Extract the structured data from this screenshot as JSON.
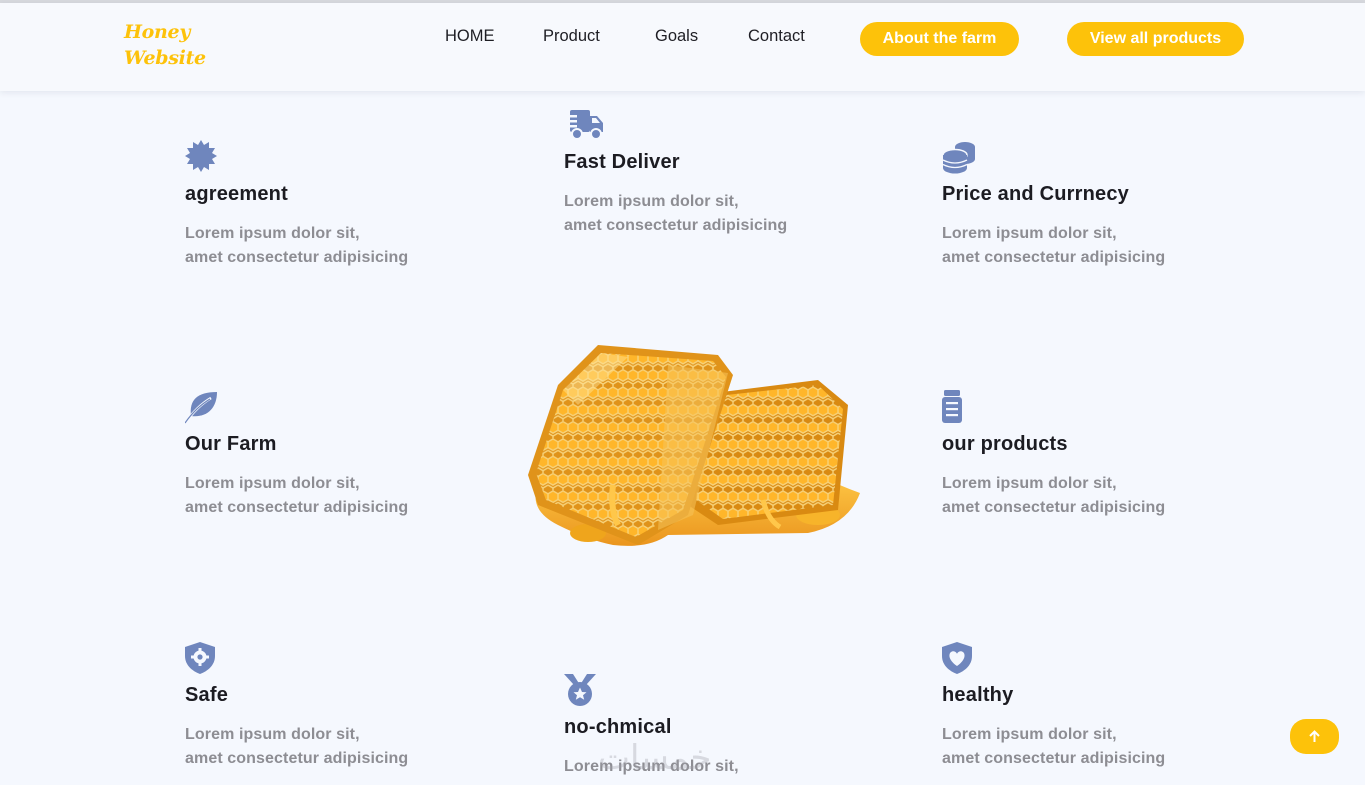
{
  "header": {
    "logo_line1": "Honey",
    "logo_line2": "Website",
    "nav": [
      "HOME",
      "Product",
      "Goals",
      "Contact"
    ],
    "btn_about": "About the farm",
    "btn_products": "View all products"
  },
  "features": [
    {
      "icon": "badge-icon",
      "title": "agreement",
      "line1": "Lorem ipsum dolor sit,",
      "line2": "amet consectetur adipisicing"
    },
    {
      "icon": "truck-fast-icon",
      "title": "Fast Deliver",
      "line1": "Lorem ipsum dolor sit,",
      "line2": "amet consectetur adipisicing"
    },
    {
      "icon": "coins-icon",
      "title": "Price and Currnecy",
      "line1": "Lorem ipsum dolor sit,",
      "line2": "amet consectetur adipisicing"
    },
    {
      "icon": "leaf-icon",
      "title": "Our Farm",
      "line1": "Lorem ipsum dolor sit,",
      "line2": "amet consectetur adipisicing"
    },
    {
      "icon": "jar-icon",
      "title": "our products",
      "line1": "Lorem ipsum dolor sit,",
      "line2": "amet consectetur adipisicing"
    },
    {
      "icon": "shield-gear-icon",
      "title": "Safe",
      "line1": "Lorem ipsum dolor sit,",
      "line2": "amet consectetur adipisicing"
    },
    {
      "icon": "medal-icon",
      "title": "no-chmical",
      "line1": "Lorem ipsum dolor sit,"
    },
    {
      "icon": "shield-heart-icon",
      "title": "healthy",
      "line1": "Lorem ipsum dolor sit,",
      "line2": "amet consectetur adipisicing"
    }
  ],
  "watermark": "خمسات",
  "colors": {
    "accent": "#fdc20a",
    "icon": "#6f86bd",
    "background": "#f5f8fe"
  }
}
